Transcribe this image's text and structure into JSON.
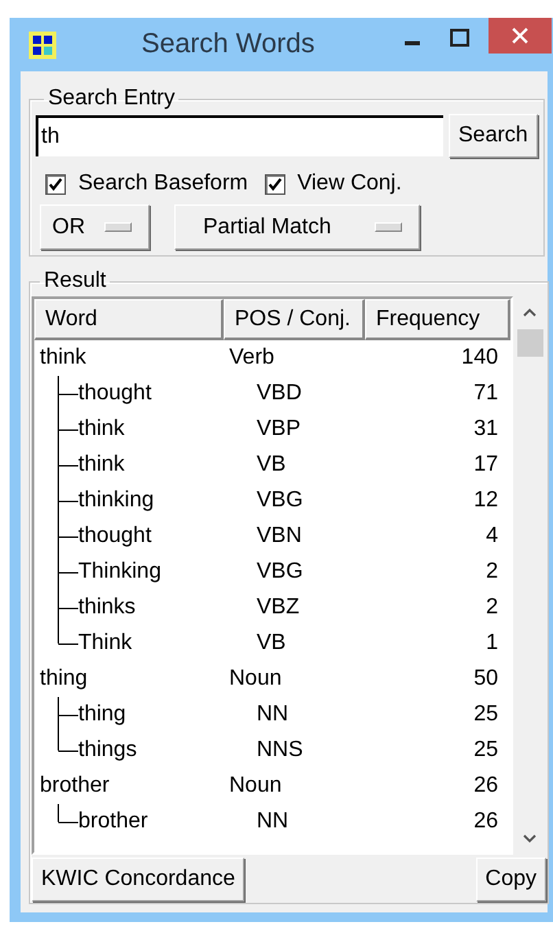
{
  "window": {
    "title": "Search Words"
  },
  "search_entry": {
    "legend": "Search Entry",
    "query": "th",
    "search_button": "Search",
    "options": [
      {
        "label": "Search Baseform",
        "checked": true
      },
      {
        "label": "View Conj.",
        "checked": true
      }
    ],
    "dropdowns": [
      {
        "value": "OR"
      },
      {
        "value": "Partial Match"
      }
    ]
  },
  "result": {
    "legend": "Result",
    "columns": [
      "Word",
      "POS / Conj.",
      "Frequency"
    ],
    "rows": [
      {
        "word": "think",
        "pos": "Verb",
        "frequency": "140",
        "children": [
          {
            "word": "thought",
            "pos": "VBD",
            "frequency": "71"
          },
          {
            "word": "think",
            "pos": "VBP",
            "frequency": "31"
          },
          {
            "word": "think",
            "pos": "VB",
            "frequency": "17"
          },
          {
            "word": "thinking",
            "pos": "VBG",
            "frequency": "12"
          },
          {
            "word": "thought",
            "pos": "VBN",
            "frequency": "4"
          },
          {
            "word": "Thinking",
            "pos": "VBG",
            "frequency": "2"
          },
          {
            "word": "thinks",
            "pos": "VBZ",
            "frequency": "2"
          },
          {
            "word": "Think",
            "pos": "VB",
            "frequency": "1"
          }
        ]
      },
      {
        "word": "thing",
        "pos": "Noun",
        "frequency": "50",
        "children": [
          {
            "word": "thing",
            "pos": "NN",
            "frequency": "25"
          },
          {
            "word": "things",
            "pos": "NNS",
            "frequency": "25"
          }
        ]
      },
      {
        "word": "brother",
        "pos": "Noun",
        "frequency": "26",
        "children": [
          {
            "word": "brother",
            "pos": "NN",
            "frequency": "26"
          }
        ]
      }
    ]
  },
  "buttons": [
    "KWIC Concordance",
    "Copy"
  ]
}
